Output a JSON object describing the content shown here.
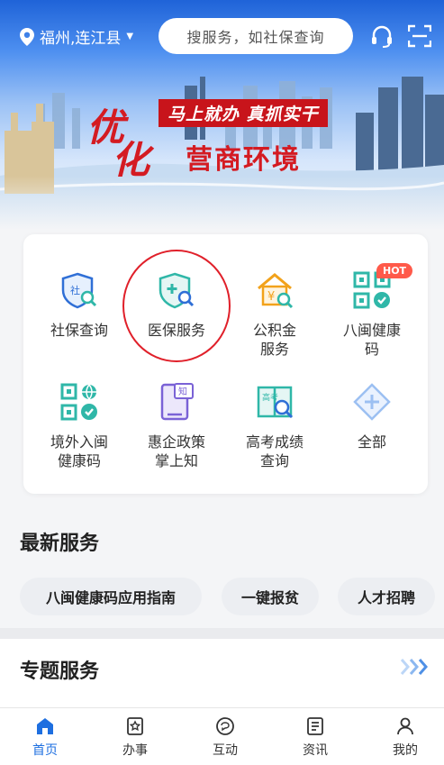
{
  "header": {
    "location": "福州,连江县",
    "search_placeholder": "搜服务，如社保查询",
    "icons": [
      "location-pin-icon",
      "caret-down-icon",
      "headset-icon",
      "scan-icon"
    ]
  },
  "banner": {
    "slogan_top": "马上就办 真抓实干",
    "slogan_big1": "优",
    "slogan_big2": "化",
    "slogan_rest": "营商环境"
  },
  "services": [
    {
      "label_lines": [
        "社保查询"
      ],
      "icon": "social-security-shield-icon"
    },
    {
      "label_lines": [
        "医保服务"
      ],
      "icon": "medical-insurance-shield-icon"
    },
    {
      "label_lines": [
        "公积金",
        "服务"
      ],
      "icon": "housing-fund-icon"
    },
    {
      "label_lines": [
        "八闽健康",
        "码"
      ],
      "icon": "health-qr-icon",
      "badge": "HOT"
    },
    {
      "label_lines": [
        "境外入闽",
        "健康码"
      ],
      "icon": "overseas-qr-icon"
    },
    {
      "label_lines": [
        "惠企政策",
        "掌上知"
      ],
      "icon": "policy-tablet-icon"
    },
    {
      "label_lines": [
        "高考成绩",
        "查询"
      ],
      "icon": "exam-score-icon"
    },
    {
      "label_lines": [
        "全部"
      ],
      "icon": "all-services-icon"
    }
  ],
  "latest": {
    "title": "最新服务",
    "chips": [
      "八闽健康码应用指南",
      "一键报贫",
      "人才招聘"
    ]
  },
  "topic": {
    "title": "专题服务"
  },
  "tabs": [
    {
      "label": "首页",
      "icon": "home-icon",
      "active": true
    },
    {
      "label": "办事",
      "icon": "tasks-icon",
      "active": false
    },
    {
      "label": "互动",
      "icon": "interact-icon",
      "active": false
    },
    {
      "label": "资讯",
      "icon": "news-icon",
      "active": false
    },
    {
      "label": "我的",
      "icon": "profile-icon",
      "active": false
    }
  ],
  "colors": {
    "accent": "#1e6fe0",
    "brand_red": "#d41b22",
    "icon_teal": "#2fb7a8",
    "hot_badge": "#ff5a4a"
  }
}
